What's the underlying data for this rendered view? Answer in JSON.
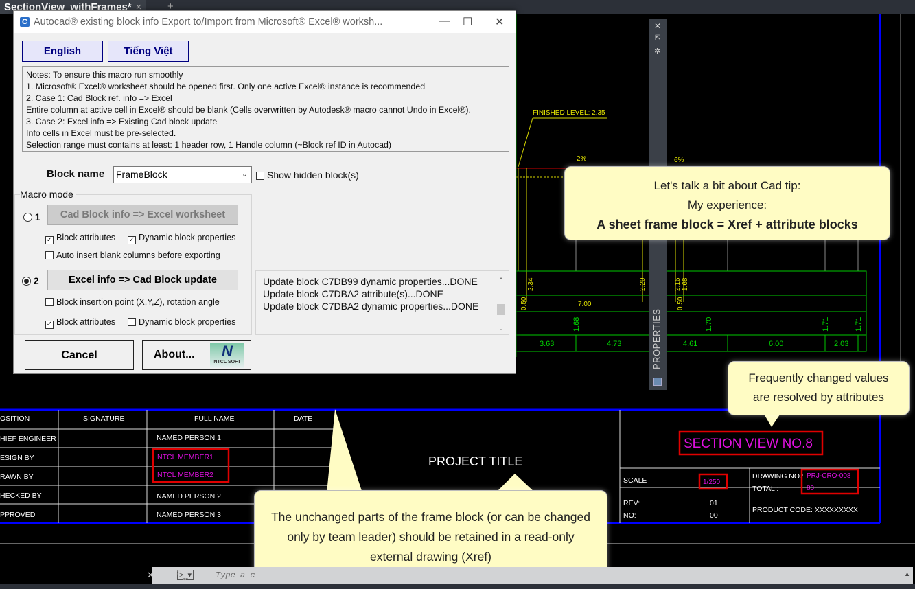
{
  "app": {
    "doc_tab": "SectionView_withFrames*",
    "tab_close": "×",
    "new_tab": "+"
  },
  "dialog": {
    "title": "Autocad® existing block info Export to/Import from Microsoft® Excel® worksh...",
    "icon_letter": "C",
    "lang": [
      "English",
      "Tiếng Việt"
    ],
    "notes": [
      "Notes: To ensure this macro run smoothly",
      "1. Microsoft® Excel® worksheet should be opened first.  Only one active Excel® instance is recommended",
      "2. Case 1: Cad Block ref. info => Excel",
      "Entire column at active cell in Excel® should be blank (Cells overwritten by Autodesk® macro cannot Undo in Excel®).",
      "3. Case 2: Excel info => Existing Cad block update",
      "Info cells in Excel must be pre-selected.",
      "Selection range must contains at least: 1 header row, 1 Handle column (~Block ref ID in Autocad)"
    ],
    "block_name_label": "Block name",
    "block_name_value": "FrameBlock",
    "show_hidden": {
      "label": "Show hidden block(s)",
      "checked": false
    },
    "macro_mode_label": "Macro mode",
    "mode1": {
      "num": "1",
      "selected": false,
      "button": "Cad Block info => Excel worksheet",
      "block_attributes": "Block attributes",
      "block_attributes_checked": true,
      "dynamic": "Dynamic block properties",
      "dynamic_checked": true,
      "auto_insert": "Auto insert blank columns before exporting",
      "auto_insert_checked": false
    },
    "mode2": {
      "num": "2",
      "selected": true,
      "button": "Excel info => Cad Block update",
      "insertion": "Block insertion point (X,Y,Z), rotation angle",
      "insertion_checked": false,
      "block_attributes": "Block attributes",
      "block_attributes_checked": true,
      "dynamic": "Dynamic block properties",
      "dynamic_checked": false
    },
    "log": [
      "Update block C7DB99 dynamic properties...DONE",
      "Update block C7DBA2 attribute(s)...DONE",
      "Update block C7DBA2 dynamic properties...DONE"
    ],
    "cancel": "Cancel",
    "about": "About...",
    "logo_text": "NTCL SOFT",
    "logo_letter": "N"
  },
  "properties_palette": {
    "title": "PROPERTIES"
  },
  "drawing": {
    "finished_level": "FINISHED LEVEL: 2.35",
    "slope1": "2%",
    "slope2": "6%",
    "row1": [
      "2.34",
      "2.20",
      "2.16",
      "1.68"
    ],
    "row2": [
      "0.50",
      "7.00",
      "0.50"
    ],
    "row3": [
      "1.68",
      "1.70",
      "1.71",
      "1.71"
    ],
    "row4": [
      "3.63",
      "4.73",
      "4.61",
      "6.00",
      "2.03"
    ],
    "title_block": {
      "headers": [
        "OSITION",
        "SIGNATURE",
        "FULL NAME",
        "DATE"
      ],
      "rows": [
        [
          "HIEF ENGINEER",
          "NAMED PERSON 1"
        ],
        [
          "ESIGN BY",
          "NTCL MEMBER1"
        ],
        [
          "RAWN BY",
          "NTCL MEMBER2"
        ],
        [
          "HECKED BY",
          "NAMED PERSON 2"
        ],
        [
          "PPROVED",
          "NAMED PERSON 3"
        ]
      ],
      "project_title": "PROJECT TITLE",
      "sheet_title": "SECTION VIEW NO.8",
      "scale_label": "SCALE",
      "scale_value": "1/250",
      "drawing_no_label": "DRAWING NO.:",
      "drawing_no": "PRJ-CRO-008",
      "total_label": "TOTAL :",
      "total": "80",
      "rev_label": "REV:",
      "rev": "01",
      "no_label": "NO:",
      "no": "00",
      "product_code": "PRODUCT CODE:   XXXXXXXXX"
    }
  },
  "callouts": {
    "tip": [
      "Let's talk a bit about Cad tip:",
      "My experience:",
      "A sheet frame block = Xref + attribute blocks"
    ],
    "attributes": "Frequently changed values are resolved by attributes",
    "xref": "The unchanged parts of the frame block (or can be changed only by team leader) should be retained in a read-only external drawing (Xref)"
  },
  "command_line": {
    "placeholder": "Type a c"
  },
  "colors": {
    "accent": "#000080",
    "callout": "#fffcc4",
    "cad_green": "#00c800",
    "cad_yellow": "#e6e600",
    "magenta": "#e010e0",
    "frame_blue": "#0000ff"
  }
}
